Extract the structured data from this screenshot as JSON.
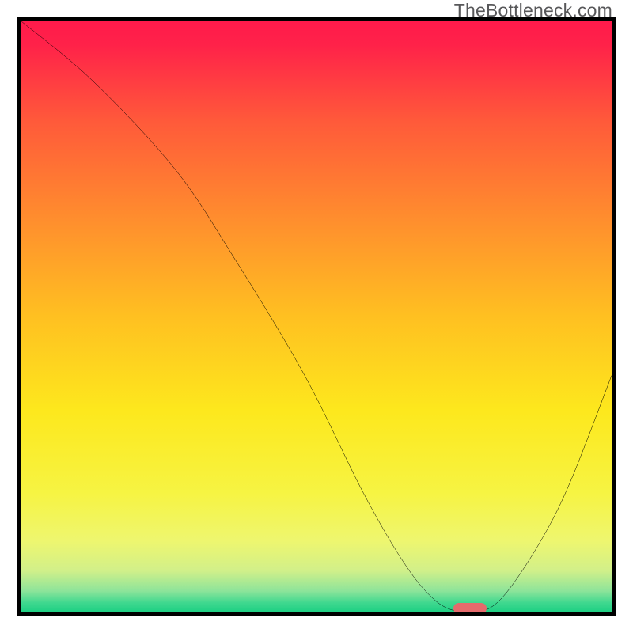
{
  "watermark": "TheBottleneck.com",
  "chart_data": {
    "type": "line",
    "title": "",
    "xlabel": "",
    "ylabel": "",
    "xlim": [
      0,
      100
    ],
    "ylim": [
      0,
      100
    ],
    "grid": false,
    "series": [
      {
        "name": "curve",
        "x": [
          0,
          12,
          26,
          36,
          48,
          58,
          65,
          70,
          74,
          78,
          82,
          88,
          93,
          100
        ],
        "values": [
          100,
          90,
          75,
          60,
          40,
          20,
          8,
          2,
          0,
          0,
          3,
          12,
          22,
          40
        ]
      }
    ],
    "marker": {
      "x": 76,
      "y": 0
    },
    "background_gradient": {
      "stops": [
        {
          "pos": 0.0,
          "color": "#ff1a4b"
        },
        {
          "pos": 0.04,
          "color": "#ff2249"
        },
        {
          "pos": 0.17,
          "color": "#ff5a3a"
        },
        {
          "pos": 0.33,
          "color": "#ff8c2e"
        },
        {
          "pos": 0.5,
          "color": "#ffc021"
        },
        {
          "pos": 0.66,
          "color": "#fde81d"
        },
        {
          "pos": 0.8,
          "color": "#f6f443"
        },
        {
          "pos": 0.88,
          "color": "#eef66f"
        },
        {
          "pos": 0.93,
          "color": "#d2f089"
        },
        {
          "pos": 0.965,
          "color": "#8de49a"
        },
        {
          "pos": 0.985,
          "color": "#3fd88f"
        },
        {
          "pos": 1.0,
          "color": "#1fd084"
        }
      ]
    }
  }
}
